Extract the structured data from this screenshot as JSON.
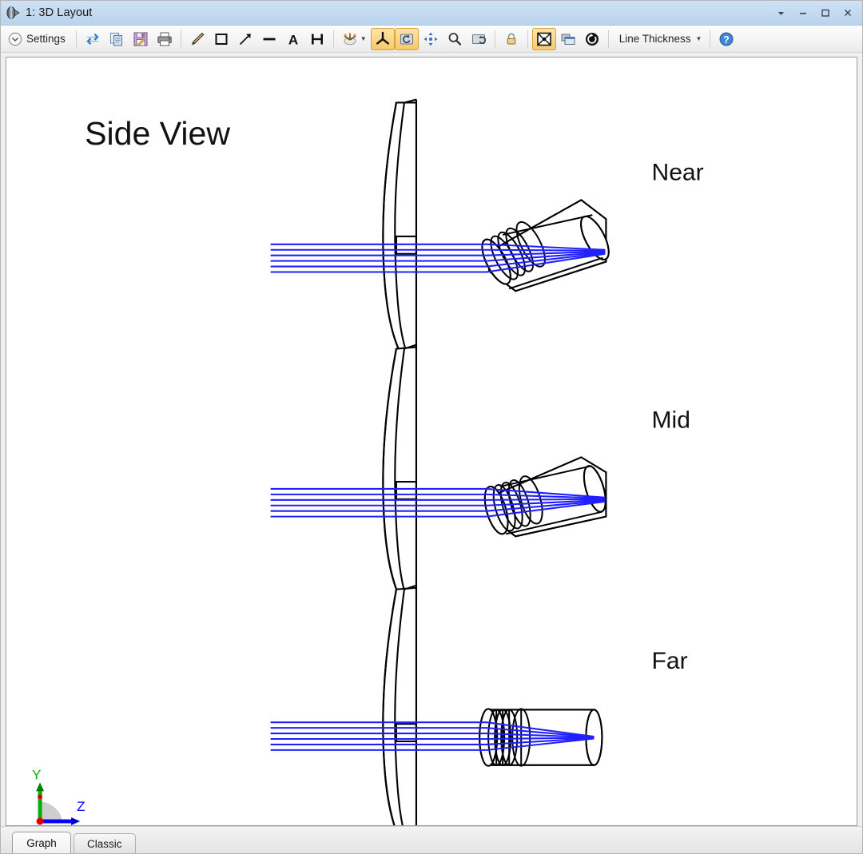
{
  "window": {
    "title": "1: 3D Layout",
    "icon": "3d-layout-icon",
    "controls": [
      {
        "name": "dropdown-arrow-button",
        "glyph": "▼"
      },
      {
        "name": "minimize-button",
        "glyph": "‒"
      },
      {
        "name": "maximize-button",
        "glyph": "□"
      },
      {
        "name": "close-button",
        "glyph": "✕"
      }
    ]
  },
  "toolbar": {
    "settings_label": "Settings",
    "line_thickness_label": "Line Thickness",
    "items": [
      {
        "name": "settings-expander-icon",
        "label": "Settings"
      },
      {
        "name": "refresh-icon",
        "label": "Refresh"
      },
      {
        "name": "copy-icon",
        "label": "Copy"
      },
      {
        "name": "save-icon",
        "label": "Save"
      },
      {
        "name": "print-icon",
        "label": "Print"
      },
      {
        "name": "pencil-annotation-icon",
        "label": "Pencil"
      },
      {
        "name": "rectangle-annotation-icon",
        "label": "Rectangle"
      },
      {
        "name": "arrow-annotation-icon",
        "label": "Arrow"
      },
      {
        "name": "line-annotation-icon",
        "label": "Line"
      },
      {
        "name": "text-annotation-icon",
        "label": "Text"
      },
      {
        "name": "dimension-annotation-icon",
        "label": "Dimension"
      },
      {
        "name": "perspective-icon",
        "label": "Perspective"
      },
      {
        "name": "axis-orientation-icon",
        "label": "Axis Orientation",
        "active": true
      },
      {
        "name": "rotate-view-icon",
        "label": "Rotate",
        "active": true
      },
      {
        "name": "pan-icon",
        "label": "Pan"
      },
      {
        "name": "zoom-icon",
        "label": "Zoom"
      },
      {
        "name": "reset-view-icon",
        "label": "Reset View"
      },
      {
        "name": "lock-icon",
        "label": "Lock"
      },
      {
        "name": "fit-to-window-icon",
        "label": "Fit To Window",
        "active": true
      },
      {
        "name": "window-arrange-icon",
        "label": "Arrange Windows"
      },
      {
        "name": "animate-icon",
        "label": "Animate"
      },
      {
        "name": "help-icon",
        "label": "Help"
      }
    ]
  },
  "graph": {
    "view_title": "Side View",
    "config_labels": [
      "Near",
      "Mid",
      "Far"
    ],
    "axis_indicator": {
      "y_label": "Y",
      "z_label": "Z",
      "y_color": "#00b000",
      "z_color": "#0000ff",
      "origin_color": "#e00000"
    },
    "ray_color": "#2020ff",
    "outline_color": "#000000",
    "background_color": "#ffffff"
  },
  "tabs": [
    {
      "name": "tab-graph",
      "label": "Graph",
      "selected": true
    },
    {
      "name": "tab-classic",
      "label": "Classic",
      "selected": false
    }
  ]
}
